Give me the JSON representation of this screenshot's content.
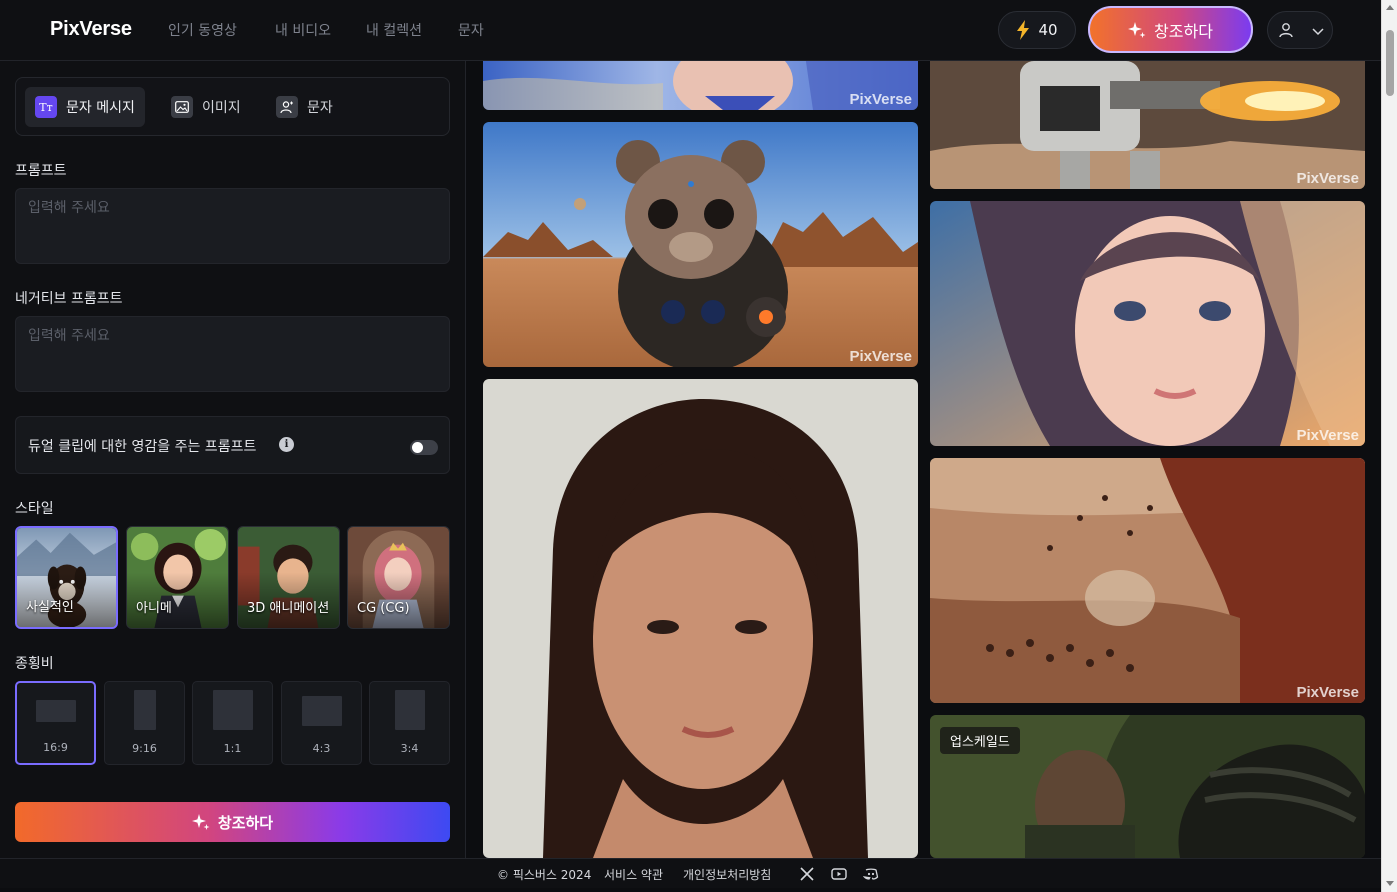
{
  "brand": "PixVerse",
  "nav": {
    "links": [
      "인기 동영상",
      "내 비디오",
      "내 컬렉션",
      "문자"
    ]
  },
  "header": {
    "credits": "40",
    "create_label": "창조하다"
  },
  "modes": [
    {
      "label": "문자 메시지",
      "icon": "text-mode-icon"
    },
    {
      "label": "이미지",
      "icon": "image-mode-icon"
    },
    {
      "label": "문자",
      "icon": "character-mode-icon"
    }
  ],
  "prompt": {
    "label": "프롬프트",
    "placeholder": "입력해 주세요",
    "value": ""
  },
  "negative_prompt": {
    "label": "네거티브 프롬프트",
    "placeholder": "입력해 주세요",
    "value": ""
  },
  "dual_clip": {
    "label": "듀얼 클립에 대한 영감을 주는 프롬프트",
    "enabled": false
  },
  "style": {
    "label": "스타일",
    "options": [
      "사실적인",
      "아니메",
      "3D 애니메이션",
      "CG (CG)"
    ],
    "selected": "사실적인"
  },
  "aspect_ratio": {
    "label": "종횡비",
    "options": [
      "16:9",
      "9:16",
      "1:1",
      "4:3",
      "3:4"
    ],
    "selected": "16:9"
  },
  "create_button": "창조하다",
  "gallery": {
    "watermark": "PixVerse",
    "badge": "업스케일드"
  },
  "footer": {
    "copyright": "© 픽스버스 2024",
    "terms": "서비스 약관",
    "privacy": "개인정보처리방침"
  },
  "colors": {
    "accent": "#6547f0",
    "selected_border": "#7a6cff",
    "background": "#0f1013"
  }
}
